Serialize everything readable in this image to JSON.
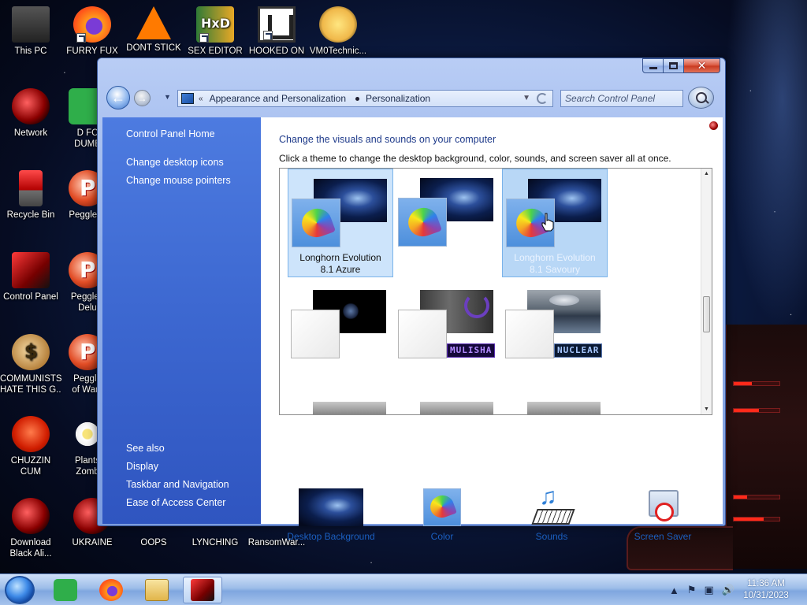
{
  "desktop": {
    "icons": [
      {
        "label": "This PC",
        "icon": "computer-icon"
      },
      {
        "label": "FURRY FUX",
        "icon": "firefox-icon"
      },
      {
        "label": "DONT STICK",
        "icon": "vlc-icon"
      },
      {
        "label": "SEX EDITOR",
        "icon": "hxd-icon"
      },
      {
        "label": "HOOKED ON",
        "icon": "hooked-icon"
      },
      {
        "label": "VM0Technic...",
        "icon": "cartoon-icon"
      },
      {
        "label": "Network",
        "icon": "network-icon"
      },
      {
        "label": "D FC",
        "label2": "DUMB",
        "icon": "app-green-icon"
      },
      {
        "label": "Recycle Bin",
        "icon": "recycle-bin-icon"
      },
      {
        "label": "Peggle D",
        "icon": "peggle-icon"
      },
      {
        "label": "Control Panel",
        "icon": "control-panel-icon"
      },
      {
        "label": "Peggle I",
        "label2": "Delu",
        "icon": "peggle-icon"
      },
      {
        "label": "COMMUNISTS",
        "label2": "HATE THIS G...",
        "icon": "money-bag-icon"
      },
      {
        "label": "Peggle",
        "label2": "of Warc",
        "icon": "peggle-icon"
      },
      {
        "label": "CHUZZIN",
        "label2": "CUM",
        "icon": "chuzzle-icon"
      },
      {
        "label": "Plants",
        "label2": "Zomb",
        "icon": "flower-icon"
      },
      {
        "label": "Download",
        "label2": "Black Ali...",
        "icon": "network-icon"
      },
      {
        "label": "UKRAINE",
        "icon": "red-orb-icon"
      },
      {
        "label": "OOPS",
        "icon": "blank-icon"
      },
      {
        "label": "LYNCHING",
        "icon": "blank-icon"
      },
      {
        "label": "RansomWar...",
        "icon": "blank-icon"
      }
    ]
  },
  "window": {
    "controls": {
      "minimize": "minimize",
      "maximize": "maximize",
      "close": "✕"
    },
    "address": {
      "chevron": "«",
      "crumbs": [
        "Appearance and Personalization",
        "Personalization"
      ]
    },
    "search_placeholder": "Search Control Panel",
    "sidebar": {
      "top_links": [
        "Control Panel Home",
        "Change desktop icons",
        "Change mouse pointers"
      ],
      "see_also_title": "See also",
      "see_also_links": [
        "Display",
        "Taskbar and Navigation",
        "Ease of Access Center"
      ]
    },
    "content": {
      "title": "Change the visuals and sounds on your computer",
      "description": "Click a theme to change the desktop background, color, sounds, and screen saver all at once.",
      "themes": [
        {
          "line1": "Longhorn Evolution",
          "line2": "8.1 Azure",
          "state": "selected"
        },
        {
          "line1": "",
          "line2": "",
          "state": "normal"
        },
        {
          "line1": "Longhorn Evolution",
          "line2": "8.1 Savoury",
          "state": "hover"
        },
        {
          "line1": "",
          "line2": "",
          "state": "normal"
        },
        {
          "line1": "",
          "line2": "",
          "state": "normal",
          "badge": "MULISHA"
        },
        {
          "line1": "",
          "line2": "",
          "state": "normal",
          "badge": "NUCLEAR"
        }
      ],
      "bottom_items": [
        "Desktop Background",
        "Color",
        "Sounds",
        "Screen Saver"
      ]
    }
  },
  "taskbar": {
    "time": "11:36 AM",
    "date": "10/31/2023"
  },
  "colors": {
    "link": "#1b5fc0",
    "title": "#1e3a8a",
    "sidebar": "#3c67d0"
  }
}
